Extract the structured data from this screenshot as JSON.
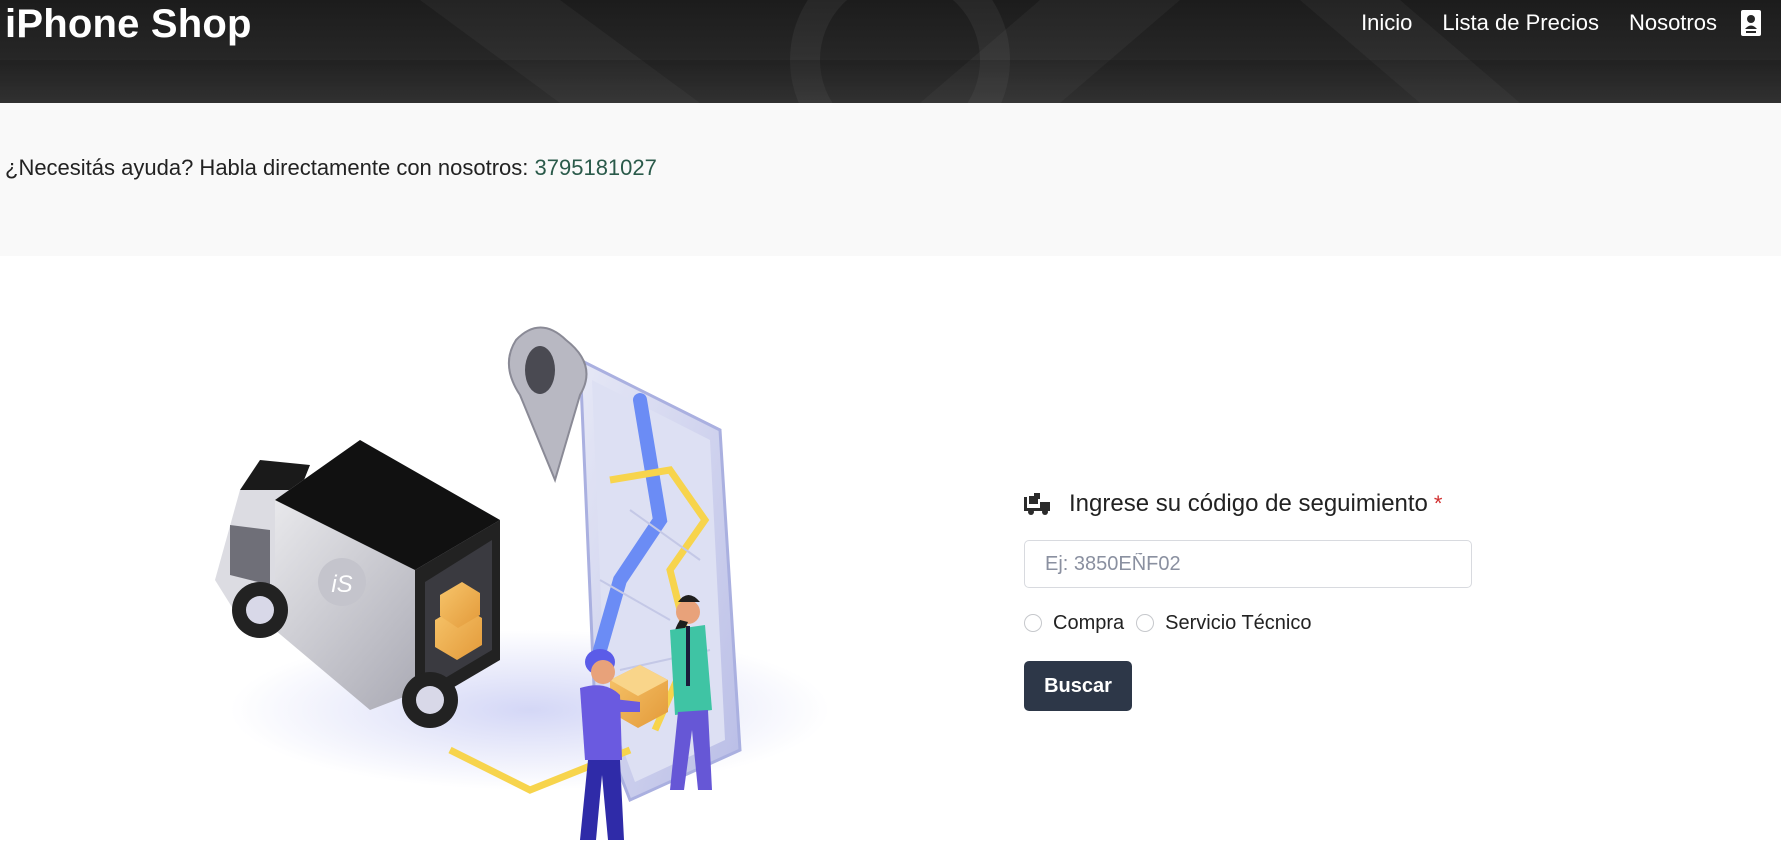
{
  "header": {
    "brand": "iPhone Shop",
    "nav": [
      "Inicio",
      "Lista de Precios",
      "Nosotros"
    ],
    "contact_icon": "contact-card-icon"
  },
  "help": {
    "text": "¿Necesitás ayuda? Habla directamente con nosotros: ",
    "phone": "3795181027",
    "phone_color": "#2a5a4a"
  },
  "illustration": {
    "truck_logo": "iS",
    "icons": [
      "delivery-truck",
      "map-pin",
      "phone-map",
      "courier-person",
      "customer-person",
      "boxes"
    ]
  },
  "form": {
    "label_icon": "truck-loading-icon",
    "label": "Ingrese su código de seguimiento",
    "required_mark": "*",
    "input": {
      "placeholder": "Ej: 3850EÑF02",
      "value": ""
    },
    "options": [
      "Compra",
      "Servicio Técnico"
    ],
    "submit": "Buscar"
  },
  "colors": {
    "header_bg": "#262626",
    "help_bg": "#f9f9f9",
    "button_bg": "#2d3748",
    "required": "#d12f2f"
  }
}
